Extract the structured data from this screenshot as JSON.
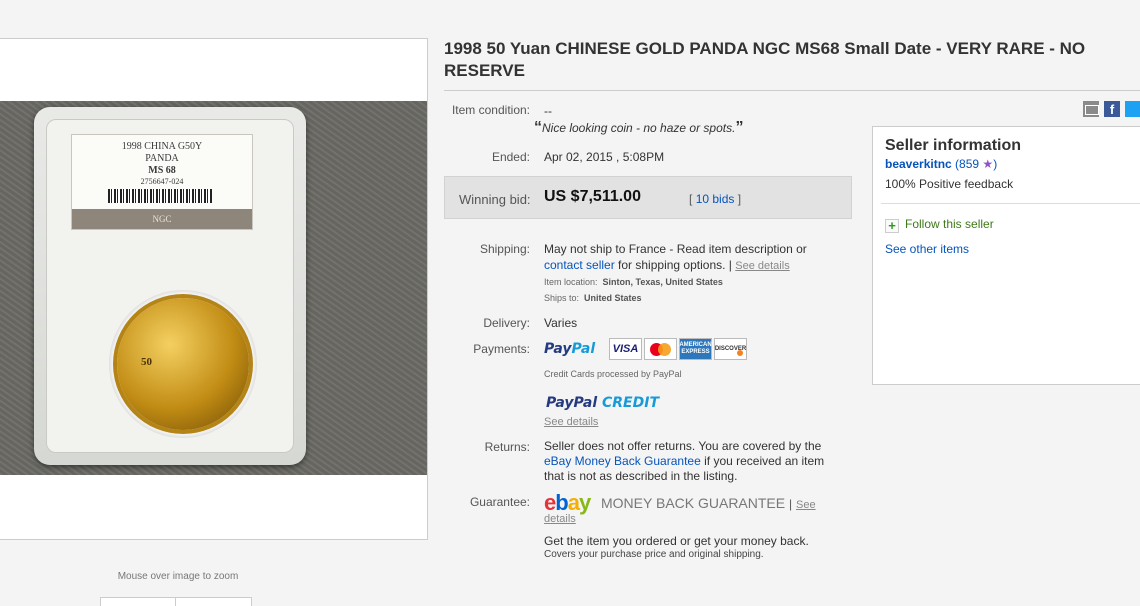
{
  "title": "1998 50 Yuan CHINESE GOLD PANDA NGC MS68 Small Date - VERY RARE - NO RESERVE",
  "image": {
    "zoom_hint": "Mouse over image to zoom",
    "label_lines": [
      "1998 CHINA G50Y",
      "PANDA",
      "MS 68",
      "2756647-024"
    ],
    "label_brand": "NGC",
    "coin_text": "50"
  },
  "item_condition": {
    "label": "Item condition:",
    "value": "--",
    "quote_open": "“",
    "quote_text": "Nice looking coin - no haze or spots.",
    "quote_close": "”"
  },
  "ended": {
    "label": "Ended:",
    "date": "Apr 02, 2015 ,",
    "time": "5:08PM"
  },
  "winning_bid": {
    "label": "Winning bid:",
    "amount": "US $7,511.00",
    "bids_open": "[",
    "bids_link": "10 bids",
    "bids_close": "]"
  },
  "shipping": {
    "label": "Shipping:",
    "line1": "May not ship to France - Read item description or",
    "contact_link": "contact seller",
    "line2_rest": "for shipping options.",
    "separator": "|",
    "see_details": "See details",
    "location_label": "Item location:",
    "location_value": "Sinton, Texas, United States",
    "ships_to_label": "Ships to:",
    "ships_to_value": "United States"
  },
  "delivery": {
    "label": "Delivery:",
    "value": "Varies"
  },
  "payments": {
    "label": "Payments:",
    "paypal_1": "Pay",
    "paypal_2": "Pal",
    "cards": [
      "VISA",
      "MasterCard",
      "AMERICAN EXPRESS",
      "DISCOVER"
    ],
    "credit_note": "Credit Cards processed by PayPal",
    "credit_logo_1": "PayPal",
    "credit_logo_2": "CREDIT",
    "see_details": "See details"
  },
  "returns": {
    "label": "Returns:",
    "line1": "Seller does not offer returns. You are covered by the",
    "link": "eBay Money Back Guarantee",
    "line2_rest": "if you received an item",
    "line3": "that is not as described in the listing."
  },
  "guarantee": {
    "label": "Guarantee:",
    "ebay_e": "e",
    "ebay_b": "b",
    "ebay_a": "a",
    "ebay_y": "y",
    "mbg": "MONEY BACK GUARANTEE",
    "separator": "|",
    "see": "See",
    "details": "details",
    "desc1": "Get the item you ordered or get your money back.",
    "desc2": "Covers your purchase price and original shipping."
  },
  "seller": {
    "heading": "Seller information",
    "name": "beaverkitnc",
    "score_open": "(",
    "score": "859",
    "score_close": ")",
    "feedback": "100% Positive feedback",
    "follow": "Follow this seller",
    "other_items": "See other items"
  },
  "colors": {
    "link": "#0654ba",
    "winbox_bg": "#e2e2e2",
    "follow_green": "#3f7a1a",
    "star_purple": "#8f55c8"
  }
}
